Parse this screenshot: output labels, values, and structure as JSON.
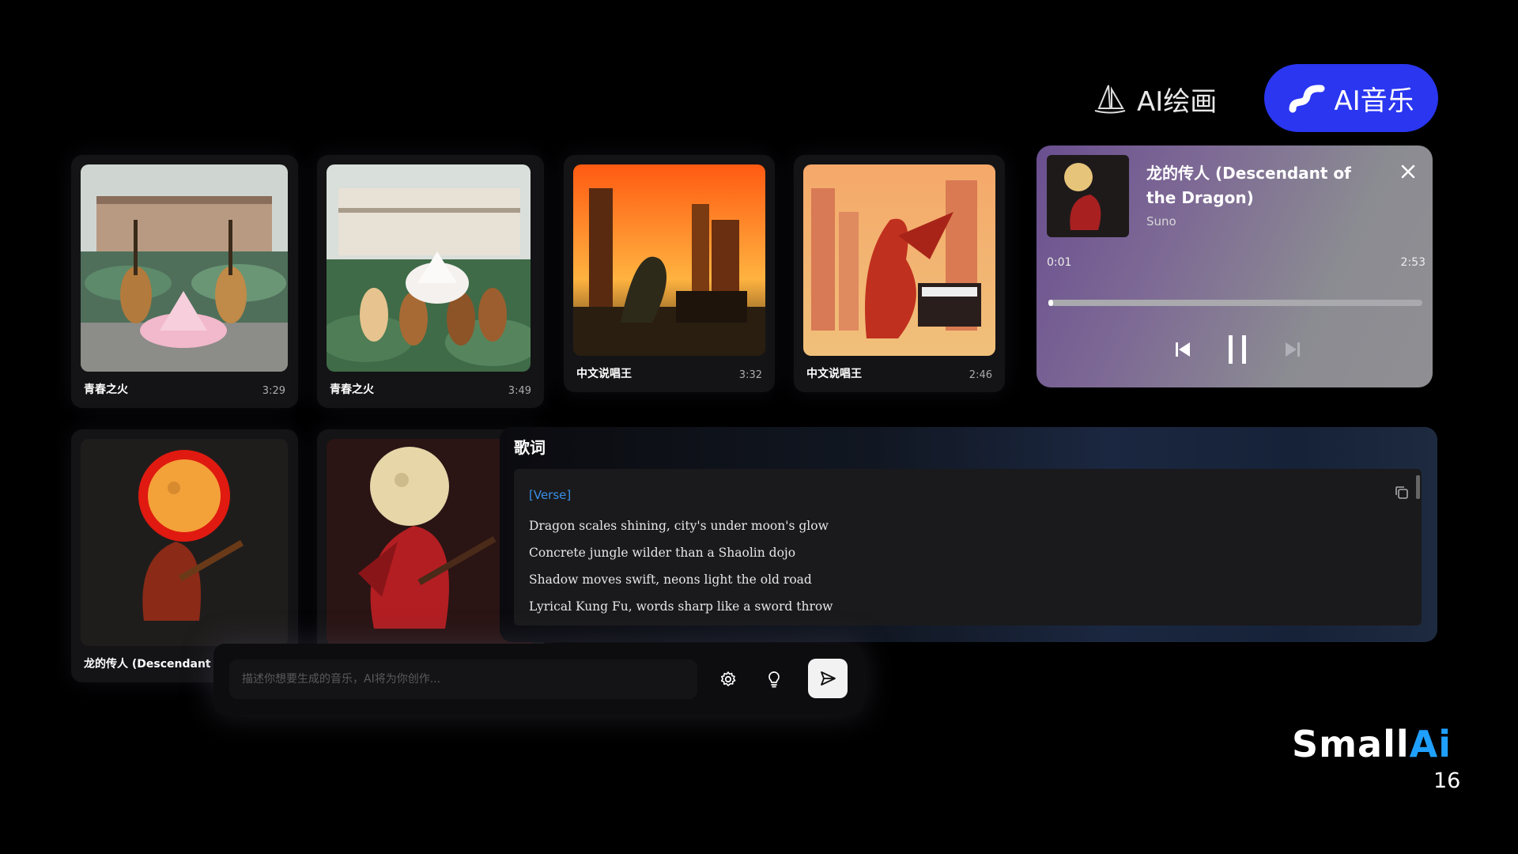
{
  "nav": {
    "draw_label": "AI绘画",
    "music_label": "AI音乐",
    "accent": "#2a36f0"
  },
  "cards": [
    {
      "title": "青春之火",
      "duration": "3:29"
    },
    {
      "title": "青春之火",
      "duration": "3:49"
    },
    {
      "title": "中文说唱王",
      "duration": "3:32"
    },
    {
      "title": "中文说唱王",
      "duration": "2:46"
    },
    {
      "title": "龙的传人 (Descendant of",
      "duration": ""
    },
    {
      "title": "",
      "duration": ""
    }
  ],
  "player": {
    "title": "龙的传人 (Descendant of the Dragon)",
    "artist": "Suno",
    "current_time": "0:01",
    "total_time": "2:53",
    "progress": 0.006
  },
  "lyrics": {
    "heading": "歌词",
    "section": "[Verse]",
    "lines": [
      "Dragon scales shining, city's under moon's glow",
      "Concrete jungle wilder than a Shaolin dojo",
      "Shadow moves swift, neons light the old road",
      "Lyrical Kung Fu, words sharp like a sword throw"
    ]
  },
  "prompt": {
    "placeholder": "描述你想要生成的音乐，AI将为你创作..."
  },
  "brand": {
    "part1": "Small",
    "part2": "Ai",
    "part2_color": "#1fa0ff",
    "page_number": "16"
  }
}
